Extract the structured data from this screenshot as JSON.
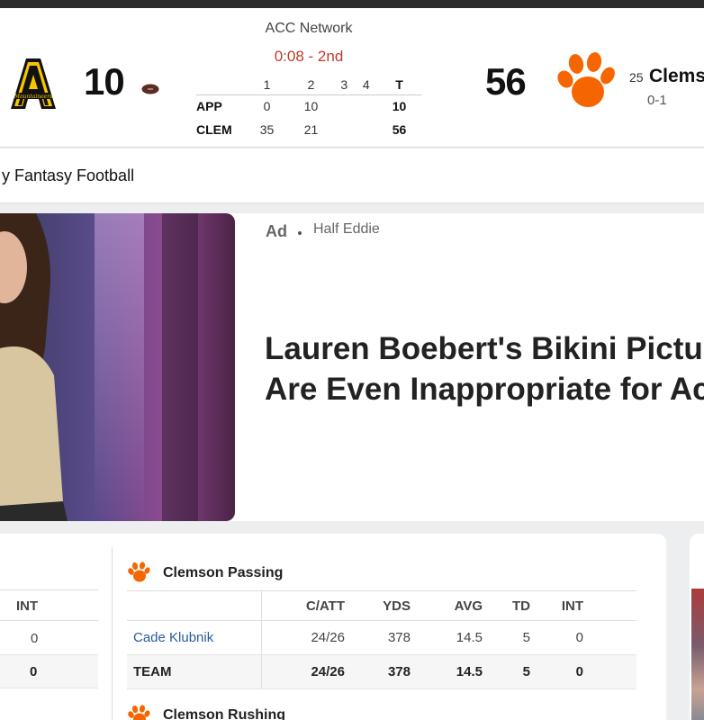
{
  "scoreboard": {
    "network": "ACC Network",
    "clock": "0:08 - 2nd",
    "away": {
      "abbr": "APP",
      "score": "10",
      "q": [
        "0",
        "10",
        "",
        ""
      ],
      "total": "10"
    },
    "home": {
      "abbr": "CLEM",
      "score": "56",
      "rank": "25",
      "name": "Clems",
      "record": "0-1",
      "q": [
        "35",
        "21",
        "",
        ""
      ],
      "total": "56"
    },
    "periods": [
      "1",
      "2",
      "3",
      "4",
      "T"
    ],
    "colors": {
      "clock": "#c0392b",
      "clemson_orange": "#f56600",
      "app_gold": "#f7c600"
    }
  },
  "nav": {
    "fantasy_label": "y Fantasy Football"
  },
  "ad": {
    "label": "Ad",
    "source": "Half Eddie",
    "headline_line1": "Lauren Boebert's Bikini Pictu",
    "headline_line2": "Are Even Inappropriate for Ac"
  },
  "left_stats": {
    "header": "INT",
    "row_value": "0",
    "team_value": "0"
  },
  "clemson_passing": {
    "title": "Clemson Passing",
    "columns": [
      "C/ATT",
      "YDS",
      "AVG",
      "TD",
      "INT"
    ],
    "rows": [
      {
        "name": "Cade Klubnik",
        "values": [
          "24/26",
          "378",
          "14.5",
          "5",
          "0"
        ]
      },
      {
        "name": "TEAM",
        "values": [
          "24/26",
          "378",
          "14.5",
          "5",
          "0"
        ]
      }
    ]
  },
  "clemson_rushing": {
    "title": "Clemson Rushing"
  }
}
